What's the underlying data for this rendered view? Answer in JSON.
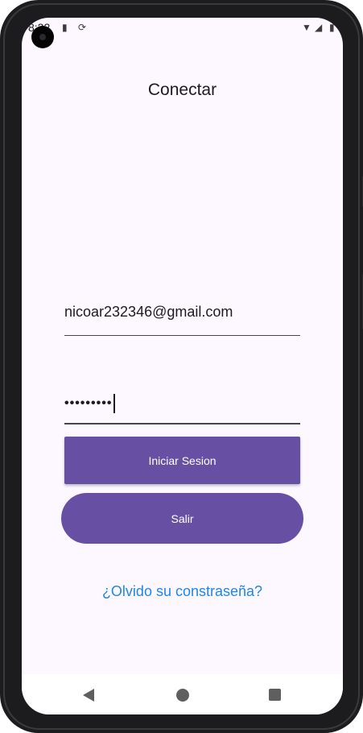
{
  "status_bar": {
    "time": "8:22",
    "icons": [
      "sd-card-icon",
      "sync-icon",
      "wifi-icon",
      "signal-icon",
      "battery-icon"
    ]
  },
  "screen": {
    "title": "Conectar"
  },
  "form": {
    "email_value": "nicoar232346@gmail.com",
    "password_value": "•••••••••"
  },
  "buttons": {
    "login_label": "Iniciar Sesion",
    "exit_label": "Salir"
  },
  "links": {
    "forgot_password": "¿Olvido su constraseña?"
  },
  "nav": {
    "items": [
      "back-icon",
      "home-icon",
      "recents-icon"
    ]
  },
  "colors": {
    "accent": "#6750a4",
    "background": "#fdf7ff",
    "link": "#1e88e5"
  }
}
